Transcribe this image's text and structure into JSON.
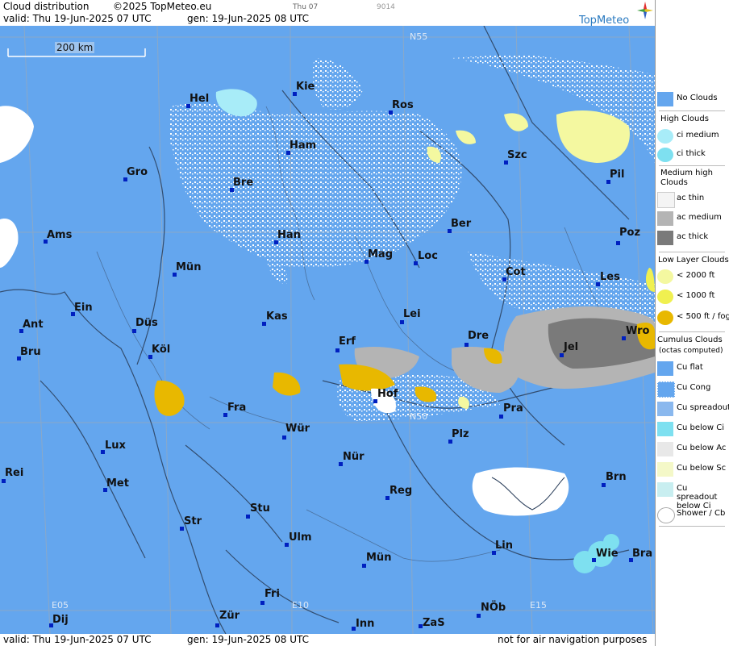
{
  "header": {
    "title": "Cloud distribution",
    "copyright": "©2025 TopMeteo.eu",
    "day_label": "Thu 07",
    "code": "9014",
    "valid": "valid:  Thu  19-Jun-2025  07 UTC",
    "gen": "gen: 19-Jun-2025 08 UTC",
    "brand": "TopMeteo"
  },
  "map": {
    "scale_label": "200 km",
    "lat_labels": [
      "N55",
      "N50"
    ],
    "lon_labels": [
      "E05",
      "E10",
      "E15"
    ],
    "cities": [
      {
        "name": "Kie"
      },
      {
        "name": "Hel"
      },
      {
        "name": "Ros"
      },
      {
        "name": "Ham"
      },
      {
        "name": "Szc"
      },
      {
        "name": "Gro"
      },
      {
        "name": "Bre"
      },
      {
        "name": "Pil"
      },
      {
        "name": "Ber"
      },
      {
        "name": "Ams"
      },
      {
        "name": "Han"
      },
      {
        "name": "Poz"
      },
      {
        "name": "Mag"
      },
      {
        "name": "Loc"
      },
      {
        "name": "Mün"
      },
      {
        "name": "Cot"
      },
      {
        "name": "Les"
      },
      {
        "name": "Ein"
      },
      {
        "name": "Kas"
      },
      {
        "name": "Lei"
      },
      {
        "name": "Ant"
      },
      {
        "name": "Düs"
      },
      {
        "name": "Dre"
      },
      {
        "name": "Wro"
      },
      {
        "name": "Erf"
      },
      {
        "name": "Bru"
      },
      {
        "name": "Köl"
      },
      {
        "name": "Jel"
      },
      {
        "name": "Hof"
      },
      {
        "name": "Fra"
      },
      {
        "name": "Pra"
      },
      {
        "name": "Wür"
      },
      {
        "name": "Plz"
      },
      {
        "name": "Lux"
      },
      {
        "name": "Nür"
      },
      {
        "name": "Rei"
      },
      {
        "name": "Met"
      },
      {
        "name": "Reg"
      },
      {
        "name": "Brn"
      },
      {
        "name": "Stu"
      },
      {
        "name": "Str"
      },
      {
        "name": "Ulm"
      },
      {
        "name": "Lin"
      },
      {
        "name": "Wie"
      },
      {
        "name": "Bra"
      },
      {
        "name": "Mün"
      },
      {
        "name": "Fri"
      },
      {
        "name": "NÖb"
      },
      {
        "name": "Dij"
      },
      {
        "name": "Zür"
      },
      {
        "name": "Inn"
      },
      {
        "name": "ZaS"
      }
    ]
  },
  "footer": {
    "valid": "valid:  Thu  19-Jun-2025  07 UTC",
    "gen": "gen: 19-Jun-2025 08 UTC",
    "note": "not for air navigation purposes"
  },
  "legend": {
    "no_clouds": "No Clouds",
    "high_head": "High Clouds",
    "ci_medium": "ci medium",
    "ci_thick": "ci thick",
    "medium_head": "Medium high Clouds",
    "ac_thin": "ac thin",
    "ac_medium": "ac medium",
    "ac_thick": "ac thick",
    "low_head": "Low Layer Clouds",
    "low_2000": "< 2000 ft",
    "low_1000": "< 1000 ft",
    "low_500": "< 500 ft / fog",
    "cu_head": "Cumulus Clouds",
    "cu_sub": "(octas computed)",
    "cu_flat": "Cu flat",
    "cu_cong": "Cu Cong",
    "cu_spread": "Cu spreadout",
    "cu_below_ci": "Cu below Ci",
    "cu_below_ac": "Cu below Ac",
    "cu_below_sc": "Cu below Sc",
    "cu_spread_ci": "Cu spreadout below Ci",
    "shower": "Shower / Cb",
    "colors": {
      "sea": "#64a6ee",
      "ci_medium": "#a8ecf8",
      "ci_thick": "#7ee0f0",
      "ac_thin": "#f4f4f4",
      "ac_medium": "#b4b4b4",
      "ac_thick": "#7a7a7a",
      "low_2000": "#f4f8a0",
      "low_1000": "#f0f050",
      "low_500": "#e8b800"
    }
  }
}
